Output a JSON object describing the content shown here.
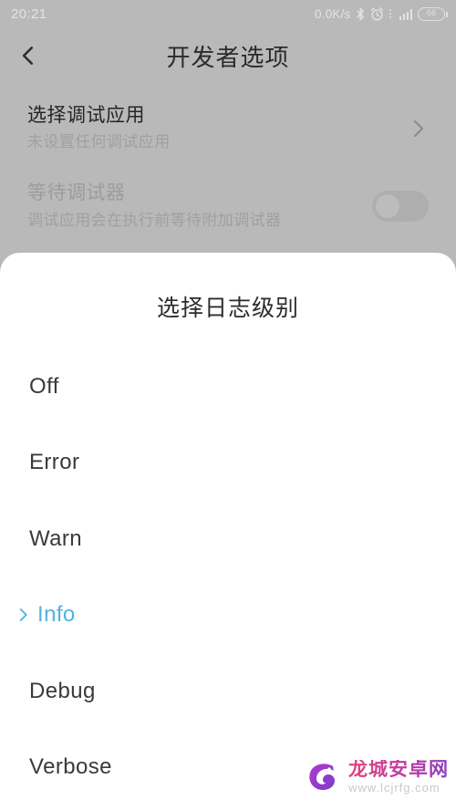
{
  "status_bar": {
    "clock": "20:21",
    "net_speed": "0.0K/s",
    "battery_level": "66",
    "icons": [
      "bluetooth-icon",
      "alarm-icon",
      "signal-icon",
      "battery-icon"
    ]
  },
  "app_bar": {
    "back_icon": "chevron-left-icon",
    "title": "开发者选项"
  },
  "settings": {
    "rows": [
      {
        "title": "选择调试应用",
        "subtitle": "未设置任何调试应用",
        "accessory": "chevron-right-icon",
        "disabled": false
      },
      {
        "title": "等待调试器",
        "subtitle": "调试应用会在执行前等待附加调试器",
        "accessory": "toggle-off",
        "disabled": true
      }
    ]
  },
  "dialog": {
    "title": "选择日志级别",
    "options": [
      {
        "label": "Off",
        "selected": false
      },
      {
        "label": "Error",
        "selected": false
      },
      {
        "label": "Warn",
        "selected": false
      },
      {
        "label": "Info",
        "selected": true
      },
      {
        "label": "Debug",
        "selected": false
      },
      {
        "label": "Verbose",
        "selected": false
      }
    ],
    "selected_chevron_icon": "chevron-right-icon"
  },
  "watermark": {
    "name": "龙城安卓网",
    "url": "www.lcjrfg.com",
    "logo_icon": "dragon-logo-icon"
  },
  "colors": {
    "background": "#b9b9b9",
    "dialog_bg": "#ffffff",
    "accent": "#4fb3e3",
    "title_text": "#2c2c2c",
    "muted_text": "#a0a0a0",
    "strip_yellow": "#f9dfa6",
    "strip_blue": "#9fd4ec",
    "strip_pink": "#f0bcc9"
  }
}
